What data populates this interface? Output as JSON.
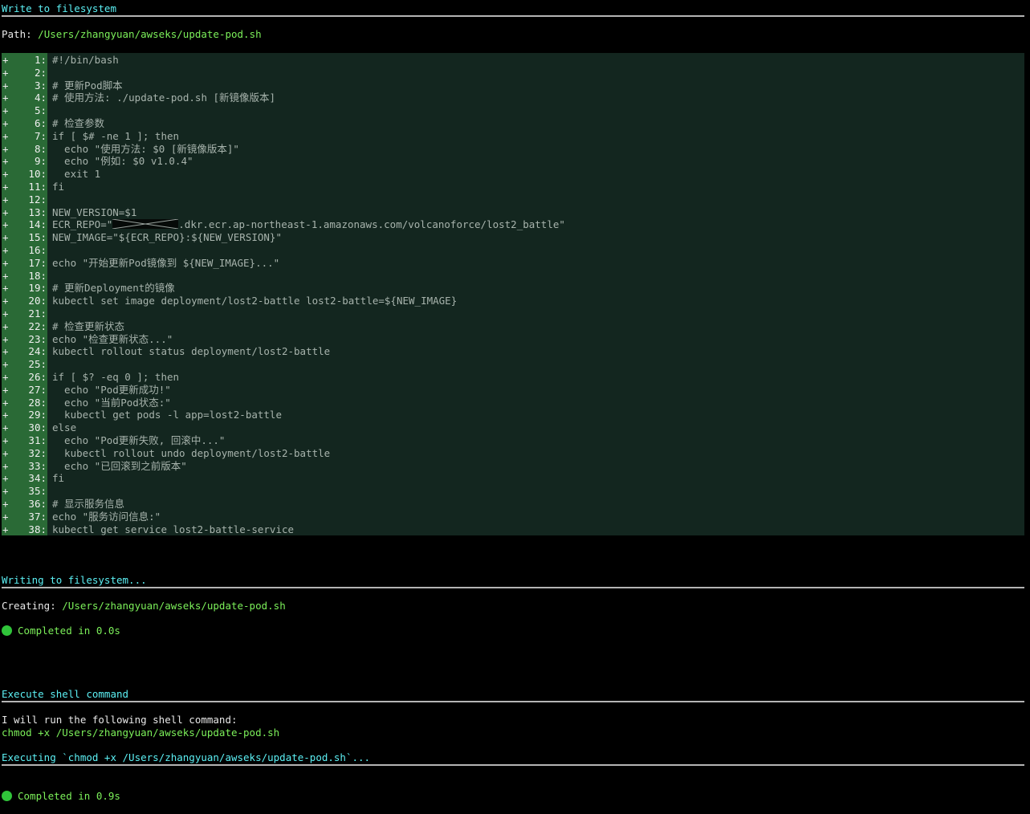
{
  "write_section": {
    "heading": "Write to filesystem",
    "path_label": "Path:",
    "path_value": "/Users/zhangyuan/awseks/update-pod.sh"
  },
  "code": {
    "marker": "+",
    "lines": [
      {
        "n": "1:",
        "text": "#!/bin/bash"
      },
      {
        "n": "2:",
        "text": ""
      },
      {
        "n": "3:",
        "text": "# 更新Pod脚本"
      },
      {
        "n": "4:",
        "text": "# 使用方法: ./update-pod.sh [新镜像版本]"
      },
      {
        "n": "5:",
        "text": ""
      },
      {
        "n": "6:",
        "text": "# 检查参数"
      },
      {
        "n": "7:",
        "text": "if [ $# -ne 1 ]; then"
      },
      {
        "n": "8:",
        "text": "  echo \"使用方法: $0 [新镜像版本]\""
      },
      {
        "n": "9:",
        "text": "  echo \"例如: $0 v1.0.4\""
      },
      {
        "n": "10:",
        "text": "  exit 1"
      },
      {
        "n": "11:",
        "text": "fi"
      },
      {
        "n": "12:",
        "text": ""
      },
      {
        "n": "13:",
        "text": "NEW_VERSION=$1"
      },
      {
        "n": "14:",
        "text": "ECR_REPO=\"",
        "redacted": true,
        "text_after": ".dkr.ecr.ap-northeast-1.amazonaws.com/volcanoforce/lost2_battle\""
      },
      {
        "n": "15:",
        "text": "NEW_IMAGE=\"${ECR_REPO}:${NEW_VERSION}\""
      },
      {
        "n": "16:",
        "text": ""
      },
      {
        "n": "17:",
        "text": "echo \"开始更新Pod镜像到 ${NEW_IMAGE}...\""
      },
      {
        "n": "18:",
        "text": ""
      },
      {
        "n": "19:",
        "text": "# 更新Deployment的镜像"
      },
      {
        "n": "20:",
        "text": "kubectl set image deployment/lost2-battle lost2-battle=${NEW_IMAGE}"
      },
      {
        "n": "21:",
        "text": ""
      },
      {
        "n": "22:",
        "text": "# 检查更新状态"
      },
      {
        "n": "23:",
        "text": "echo \"检查更新状态...\""
      },
      {
        "n": "24:",
        "text": "kubectl rollout status deployment/lost2-battle"
      },
      {
        "n": "25:",
        "text": ""
      },
      {
        "n": "26:",
        "text": "if [ $? -eq 0 ]; then"
      },
      {
        "n": "27:",
        "text": "  echo \"Pod更新成功!\""
      },
      {
        "n": "28:",
        "text": "  echo \"当前Pod状态:\""
      },
      {
        "n": "29:",
        "text": "  kubectl get pods -l app=lost2-battle"
      },
      {
        "n": "30:",
        "text": "else"
      },
      {
        "n": "31:",
        "text": "  echo \"Pod更新失败, 回滚中...\""
      },
      {
        "n": "32:",
        "text": "  kubectl rollout undo deployment/lost2-battle"
      },
      {
        "n": "33:",
        "text": "  echo \"已回滚到之前版本\""
      },
      {
        "n": "34:",
        "text": "fi"
      },
      {
        "n": "35:",
        "text": ""
      },
      {
        "n": "36:",
        "text": "# 显示服务信息"
      },
      {
        "n": "37:",
        "text": "echo \"服务访问信息:\""
      },
      {
        "n": "38:",
        "text": "kubectl get service lost2-battle-service"
      }
    ]
  },
  "writing_section": {
    "heading": "Writing to filesystem...",
    "creating_label": "Creating:",
    "creating_path": "/Users/zhangyuan/awseks/update-pod.sh",
    "completed": "Completed in 0.0s"
  },
  "shell_section": {
    "heading": "Execute shell command",
    "intro": "I will run the following shell command:",
    "command": "chmod +x /Users/zhangyuan/awseks/update-pod.sh",
    "executing": "Executing `chmod +x /Users/zhangyuan/awseks/update-pod.sh`...",
    "completed": "Completed in 0.9s"
  },
  "colors": {
    "background": "#000000",
    "heading": "#5cf0f4",
    "path_green": "#7cf05a",
    "gutter_green": "#2a6a36",
    "code_bg": "#13261f",
    "status_dot": "#30c43a"
  },
  "icons": {
    "status": "green-circle-icon"
  }
}
